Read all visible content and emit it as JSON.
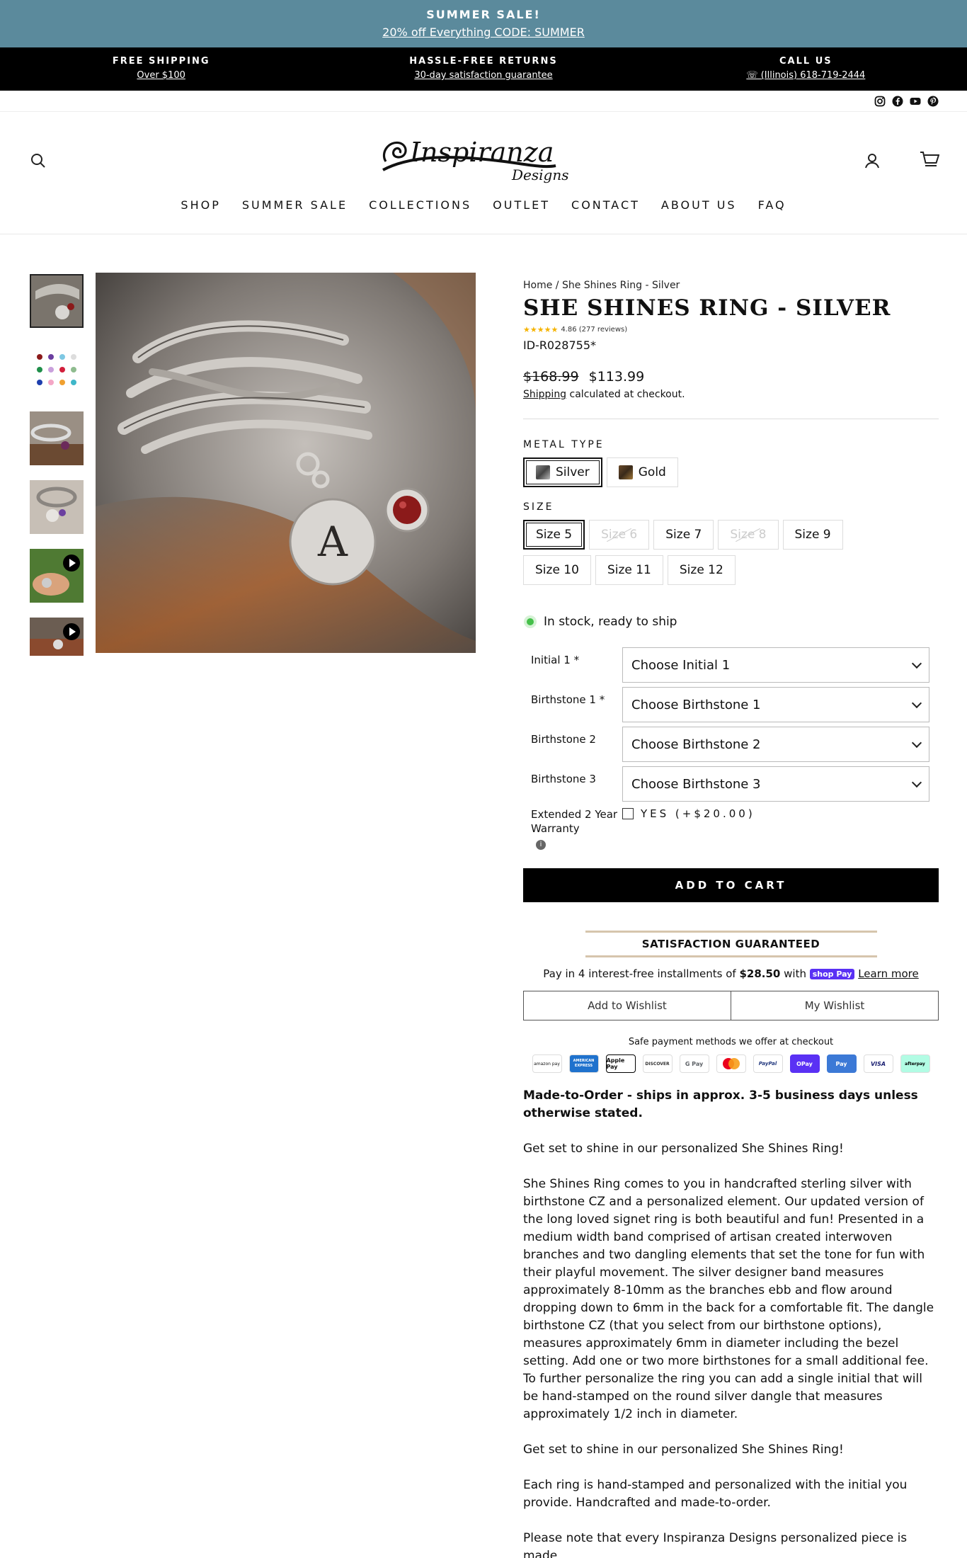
{
  "announcement": {
    "title": "SUMMER SALE!",
    "link": "20% off Everything CODE: SUMMER"
  },
  "infobar": [
    {
      "title": "FREE SHIPPING",
      "sub": "Over $100"
    },
    {
      "title": "HASSLE-FREE RETURNS",
      "sub": "30-day satisfaction guarantee"
    },
    {
      "title": "CALL US",
      "sub": "☏ (Illinois) 618-719-2444"
    }
  ],
  "social_icons": [
    "instagram-icon",
    "facebook-icon",
    "youtube-icon",
    "pinterest-icon"
  ],
  "header": {
    "logo": {
      "word1": "Inspiranza",
      "word2": "Designs"
    },
    "nav": [
      "SHOP",
      "SUMMER SALE",
      "COLLECTIONS",
      "OUTLET",
      "CONTACT",
      "ABOUT US",
      "FAQ"
    ]
  },
  "product": {
    "breadcrumb": "Home / She Shines Ring - Silver",
    "title": "SHE SHINES RING - SILVER",
    "stars": "★★★★★",
    "rating_text": "4.86 (277 reviews)",
    "sku": "ID-R028755*",
    "old_price": "$168.99",
    "price": "$113.99",
    "shipping_link": "Shipping",
    "shipping_rest": "calculated at checkout.",
    "metal_label": "METAL TYPE",
    "metals": [
      "Silver",
      "Gold"
    ],
    "size_label": "SIZE",
    "sizes": [
      "Size 5",
      "Size 6",
      "Size 7",
      "Size 8",
      "Size 9",
      "Size 10",
      "Size 11",
      "Size 12"
    ],
    "stock": "In stock, ready to ship",
    "props": [
      {
        "label": "Initial 1 *",
        "value": "Choose Initial 1"
      },
      {
        "label": "Birthstone 1 *",
        "value": "Choose Birthstone 1"
      },
      {
        "label": "Birthstone 2",
        "value": "Choose Birthstone 2"
      },
      {
        "label": "Birthstone 3",
        "value": "Choose Birthstone 3"
      }
    ],
    "warranty_label": "Extended 2 Year Warranty",
    "warranty_option": "YES (+$20.00)",
    "add_to_cart": "ADD TO CART",
    "satisfaction": "SATISFACTION GUARANTEED",
    "installments_prefix": "Pay in 4 interest-free installments of",
    "installments_amount": "$28.50",
    "installments_with": "with",
    "shoppay": "shop Pay",
    "learn_more": "Learn more",
    "wishlist_add": "Add to Wishlist",
    "wishlist_my": "My Wishlist",
    "safe_payments": "Safe payment methods we offer at checkout",
    "payment_icons": [
      "amazon pay",
      "AMERICAN EXPRESS",
      "Apple Pay",
      "DISCOVER",
      "G Pay",
      "mastercard",
      "PayPal",
      "OPay",
      "Pay",
      "VISA",
      "afterpay"
    ],
    "description": {
      "lead": "Made-to-Order - ships in approx. 3-5 business days unless otherwise stated.",
      "p1": "Get set to shine in our personalized She Shines Ring!",
      "p2": "She Shines Ring comes to you in handcrafted sterling silver with birthstone CZ and a personalized element. Our updated version of the long loved signet ring is both beautiful and fun! Presented in a medium width band comprised of artisan created interwoven branches and two dangling elements that set the tone for fun with their playful movement. The silver designer band measures approximately 8-10mm as the branches ebb and flow around dropping down to 6mm in the back for a comfortable fit. The dangle birthstone CZ (that you select from our birthstone options), measures approximately 6mm in diameter including the bezel setting. Add one or two more birthstones for a small additional fee. To further personalize the ring you can add a single initial that will be hand-stamped on the round silver dangle that measures approximately 1/2 inch in diameter.",
      "p3": "Get set to shine in our personalized She Shines Ring!",
      "p4": "Each ring is hand-stamped and personalized with the initial you provide. Handcrafted and made-to-order.",
      "p5": "Please note that every Inspiranza Designs personalized piece is made"
    },
    "image_letter": "A"
  }
}
